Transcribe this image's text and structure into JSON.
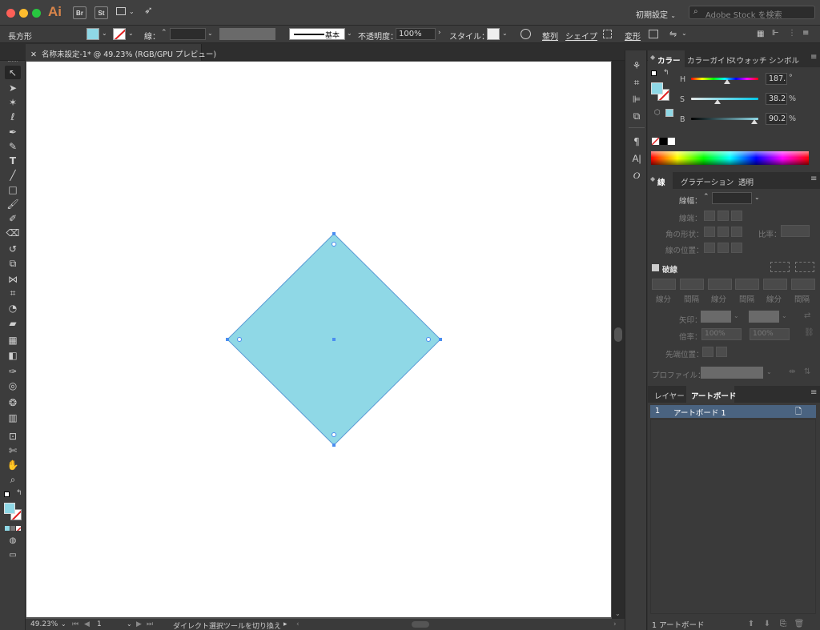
{
  "app": {
    "logo": "Ai",
    "bridge": "Br",
    "stock": "St",
    "workspace": "初期設定",
    "search_placeholder": "Adobe Stock を検索"
  },
  "control_bar": {
    "tool_name": "長方形",
    "stroke_label": "線：",
    "stroke_profile": "基本",
    "opacity_label": "不透明度：",
    "opacity_value": "100%",
    "style_label": "スタイル：",
    "align_label": "整列",
    "shape_label": "シェイプ",
    "transform_label": "変形",
    "fill_color": "#8fd8e6"
  },
  "document": {
    "tab_title": "名称未設定-1* @ 49.23% (RGB/GPU プレビュー)",
    "zoom": "49.23%",
    "artboard_number": "1",
    "status_text": "ダイレクト選択ツールを切り換え",
    "shape_fill": "#8fd8e6",
    "shape_stroke": "#5b9bd5"
  },
  "color_panel": {
    "tabs": [
      "カラー",
      "カラーガイド",
      "スウォッチ",
      "シンボル"
    ],
    "h_label": "H",
    "h_value": "187.",
    "h_unit": "°",
    "s_label": "S",
    "s_value": "38.2",
    "s_unit": "%",
    "b_label": "B",
    "b_value": "90.2",
    "b_unit": "%"
  },
  "stroke_panel": {
    "tabs": [
      "線",
      "グラデーション",
      "透明"
    ],
    "weight_label": "線幅：",
    "cap_label": "線端：",
    "corner_label": "角の形状：",
    "limit_label": "比率：",
    "align_label": "線の位置：",
    "dash_label": "破線",
    "dash_cols": [
      "線分",
      "間隔",
      "線分",
      "間隔",
      "線分",
      "間隔"
    ],
    "arrow_label": "矢印：",
    "scale_label": "倍率：",
    "scale_value_1": "100%",
    "scale_value_2": "100%",
    "tip_label": "先端位置：",
    "profile_label": "プロファイル："
  },
  "layers_panel": {
    "tabs": [
      "レイヤー",
      "アートボード"
    ],
    "rows": [
      {
        "number": "1",
        "name": "アートボード 1"
      }
    ],
    "footer": "1 アートボード"
  }
}
